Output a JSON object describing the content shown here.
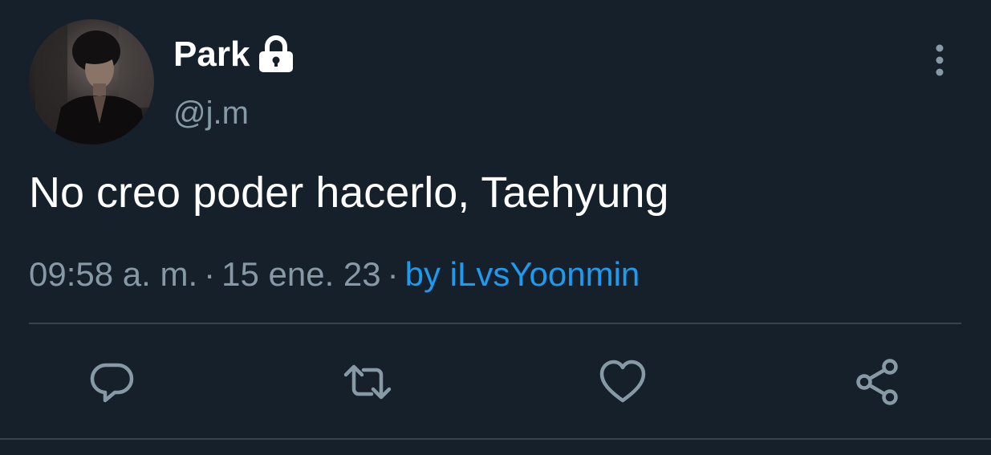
{
  "colors": {
    "background": "#15202b",
    "text_primary": "#ffffff",
    "text_secondary": "#8899a6",
    "link": "#1d9bf0",
    "divider": "#38444d"
  },
  "author": {
    "display_name": "Park",
    "handle": "@j.m",
    "protected_icon": "lock-icon",
    "avatar_icon": "avatar-photo"
  },
  "tweet": {
    "text": "No creo poder hacerlo, Taehyung"
  },
  "meta": {
    "time": "09:58 a. m.",
    "separator": "·",
    "date": "15 ene. 23",
    "source": "by iLvsYoonmin"
  },
  "actions": [
    {
      "name": "reply",
      "icon": "reply-icon"
    },
    {
      "name": "retweet",
      "icon": "retweet-icon"
    },
    {
      "name": "like",
      "icon": "heart-icon"
    },
    {
      "name": "share",
      "icon": "share-icon"
    }
  ],
  "menu": {
    "icon": "more-vertical-icon"
  }
}
